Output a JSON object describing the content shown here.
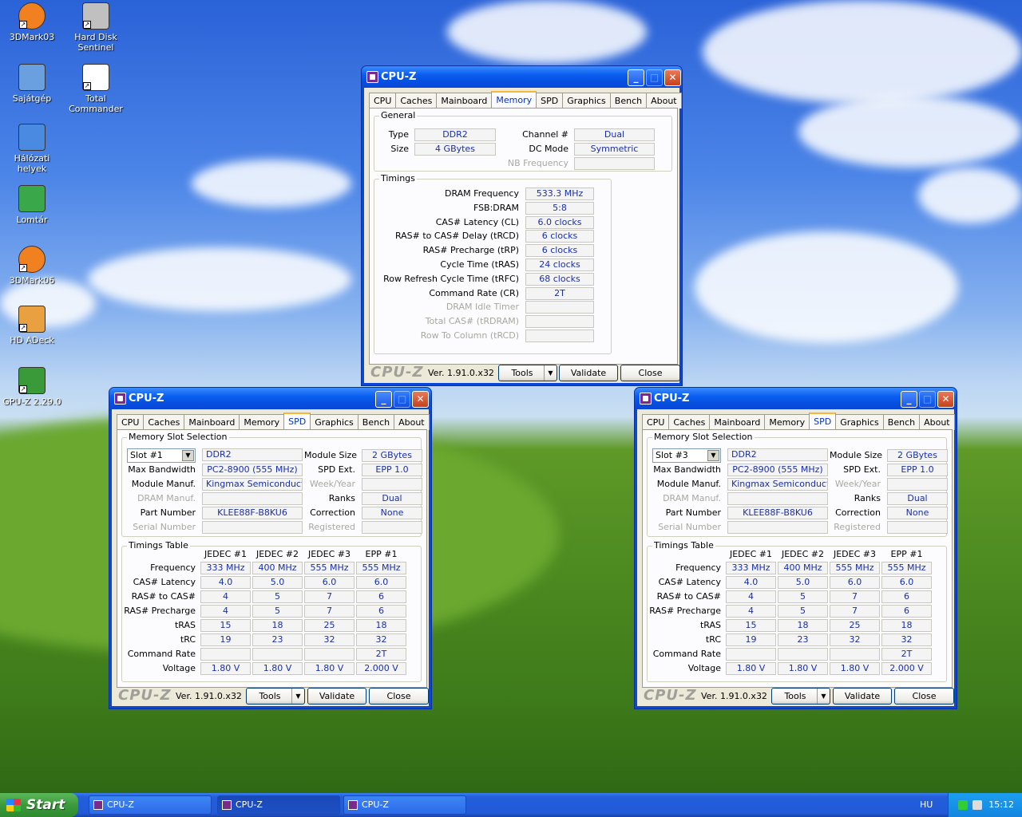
{
  "desktop": {
    "icons": [
      {
        "label": "3DMark03",
        "icon": "3dmark-icon"
      },
      {
        "label": "Hard Disk Sentinel",
        "icon": "harddisk-icon"
      },
      {
        "label": "Sajátgép",
        "icon": "computer-icon"
      },
      {
        "label": "Total Commander",
        "icon": "floppy-icon"
      },
      {
        "label": "Hálózati helyek",
        "icon": "network-icon"
      },
      {
        "label": "Lomtár",
        "icon": "recycle-bin-icon"
      },
      {
        "label": "3DMark06",
        "icon": "3dmark-icon"
      },
      {
        "label": "HD ADeck",
        "icon": "audio-icon"
      },
      {
        "label": "GPU-Z 2.29.0",
        "icon": "gpu-card-icon"
      }
    ]
  },
  "tabs": [
    "CPU",
    "Caches",
    "Mainboard",
    "Memory",
    "SPD",
    "Graphics",
    "Bench",
    "About"
  ],
  "footer": {
    "brand": "CPU-Z",
    "version": "Ver. 1.91.0.x32",
    "tools": "Tools",
    "validate": "Validate",
    "close": "Close",
    "dropdown_arrow": "▼"
  },
  "memory_window": {
    "title": "CPU-Z",
    "active_tab": "Memory",
    "general": {
      "label": "General",
      "type_label": "Type",
      "type": "DDR2",
      "size_label": "Size",
      "size": "4 GBytes",
      "channel_label": "Channel #",
      "channel": "Dual",
      "dc_label": "DC Mode",
      "dc": "Symmetric",
      "nb_label": "NB Frequency",
      "nb": ""
    },
    "timings": {
      "label": "Timings",
      "rows": [
        {
          "label": "DRAM Frequency",
          "value": "533.3 MHz",
          "dim": false
        },
        {
          "label": "FSB:DRAM",
          "value": "5:8",
          "dim": false
        },
        {
          "label": "CAS# Latency (CL)",
          "value": "6.0 clocks",
          "dim": false
        },
        {
          "label": "RAS# to CAS# Delay (tRCD)",
          "value": "6 clocks",
          "dim": false
        },
        {
          "label": "RAS# Precharge (tRP)",
          "value": "6 clocks",
          "dim": false
        },
        {
          "label": "Cycle Time (tRAS)",
          "value": "24 clocks",
          "dim": false
        },
        {
          "label": "Row Refresh Cycle Time (tRFC)",
          "value": "68 clocks",
          "dim": false
        },
        {
          "label": "Command Rate (CR)",
          "value": "2T",
          "dim": false
        },
        {
          "label": "DRAM Idle Timer",
          "value": "",
          "dim": true
        },
        {
          "label": "Total CAS# (tRDRAM)",
          "value": "",
          "dim": true
        },
        {
          "label": "Row To Column (tRCD)",
          "value": "",
          "dim": true
        }
      ]
    }
  },
  "spd_windows": [
    {
      "title": "CPU-Z",
      "slot": "Slot #1",
      "slot_group": "Memory Slot Selection",
      "mem_type": "DDR2",
      "module_size_label": "Module Size",
      "module_size": "2 GBytes",
      "max_bw_label": "Max Bandwidth",
      "max_bw": "PC2-8900 (555 MHz)",
      "spd_ext_label": "SPD Ext.",
      "spd_ext": "EPP 1.0",
      "manuf_label": "Module Manuf.",
      "manuf": "Kingmax Semiconductor",
      "week_label": "Week/Year",
      "week": "",
      "dram_manuf_label": "DRAM Manuf.",
      "dram_manuf": "",
      "ranks_label": "Ranks",
      "ranks": "Dual",
      "part_label": "Part Number",
      "part": "KLEE88F-B8KU6",
      "correction_label": "Correction",
      "correction": "None",
      "serial_label": "Serial Number",
      "serial": "",
      "registered_label": "Registered",
      "registered": "",
      "timings_label": "Timings Table",
      "columns": [
        "JEDEC #1",
        "JEDEC #2",
        "JEDEC #3",
        "EPP #1"
      ],
      "rows": [
        {
          "label": "Frequency",
          "values": [
            "333 MHz",
            "400 MHz",
            "555 MHz",
            "555 MHz"
          ]
        },
        {
          "label": "CAS# Latency",
          "values": [
            "4.0",
            "5.0",
            "6.0",
            "6.0"
          ]
        },
        {
          "label": "RAS# to CAS#",
          "values": [
            "4",
            "5",
            "7",
            "6"
          ]
        },
        {
          "label": "RAS# Precharge",
          "values": [
            "4",
            "5",
            "7",
            "6"
          ]
        },
        {
          "label": "tRAS",
          "values": [
            "15",
            "18",
            "25",
            "18"
          ]
        },
        {
          "label": "tRC",
          "values": [
            "19",
            "23",
            "32",
            "32"
          ]
        },
        {
          "label": "Command Rate",
          "values": [
            "",
            "",
            "",
            "2T"
          ]
        },
        {
          "label": "Voltage",
          "values": [
            "1.80 V",
            "1.80 V",
            "1.80 V",
            "2.000 V"
          ]
        }
      ]
    },
    {
      "title": "CPU-Z",
      "slot": "Slot #3",
      "slot_group": "Memory Slot Selection",
      "mem_type": "DDR2",
      "module_size_label": "Module Size",
      "module_size": "2 GBytes",
      "max_bw_label": "Max Bandwidth",
      "max_bw": "PC2-8900 (555 MHz)",
      "spd_ext_label": "SPD Ext.",
      "spd_ext": "EPP 1.0",
      "manuf_label": "Module Manuf.",
      "manuf": "Kingmax Semiconductor",
      "week_label": "Week/Year",
      "week": "",
      "dram_manuf_label": "DRAM Manuf.",
      "dram_manuf": "",
      "ranks_label": "Ranks",
      "ranks": "Dual",
      "part_label": "Part Number",
      "part": "KLEE88F-B8KU6",
      "correction_label": "Correction",
      "correction": "None",
      "serial_label": "Serial Number",
      "serial": "",
      "registered_label": "Registered",
      "registered": "",
      "timings_label": "Timings Table",
      "columns": [
        "JEDEC #1",
        "JEDEC #2",
        "JEDEC #3",
        "EPP #1"
      ],
      "rows": [
        {
          "label": "Frequency",
          "values": [
            "333 MHz",
            "400 MHz",
            "555 MHz",
            "555 MHz"
          ]
        },
        {
          "label": "CAS# Latency",
          "values": [
            "4.0",
            "5.0",
            "6.0",
            "6.0"
          ]
        },
        {
          "label": "RAS# to CAS#",
          "values": [
            "4",
            "5",
            "7",
            "6"
          ]
        },
        {
          "label": "RAS# Precharge",
          "values": [
            "4",
            "5",
            "7",
            "6"
          ]
        },
        {
          "label": "tRAS",
          "values": [
            "15",
            "18",
            "25",
            "18"
          ]
        },
        {
          "label": "tRC",
          "values": [
            "19",
            "23",
            "32",
            "32"
          ]
        },
        {
          "label": "Command Rate",
          "values": [
            "",
            "",
            "",
            "2T"
          ]
        },
        {
          "label": "Voltage",
          "values": [
            "1.80 V",
            "1.80 V",
            "1.80 V",
            "2.000 V"
          ]
        }
      ]
    }
  ],
  "taskbar": {
    "start": "Start",
    "tasks": [
      {
        "label": "CPU-Z"
      },
      {
        "label": "CPU-Z"
      },
      {
        "label": "CPU-Z"
      }
    ],
    "lang": "HU",
    "clock": "15:12"
  }
}
